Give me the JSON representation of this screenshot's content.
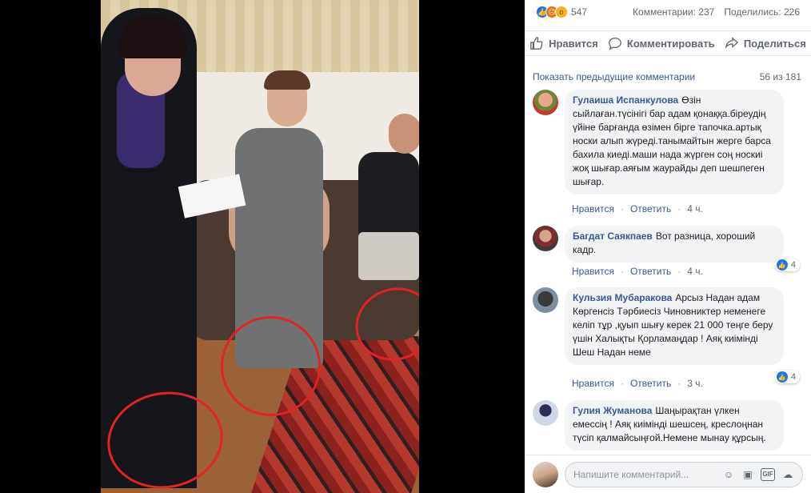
{
  "stats": {
    "reaction_count": "547",
    "comments": "Комментарии: 237",
    "shares": "Поделились: 226"
  },
  "actions": {
    "like": "Нравится",
    "comment": "Комментировать",
    "share": "Поделиться"
  },
  "previous": {
    "link": "Показать предыдущие комментарии",
    "count": "56 из 181"
  },
  "comments": [
    {
      "name": "Гулаиша Испанкулова",
      "text": "Өзін сыйлаған.түсінігі бар адам қонаққа.біреудің үйіне барғанда өзімен бірге тапочка.артық носки алып жүреді.танымайтын жерге барса бахила киеді.маши нада жүрген соң носкиі жоқ шығар.аяғым жаурайды деп шешпеген шығар.",
      "like": "Нравится",
      "reply": "Ответить",
      "time": "4 ч."
    },
    {
      "name": "Багдат Саякпаев",
      "text": "Вот разница, хороший кадр.",
      "like": "Нравится",
      "reply": "Ответить",
      "time": "4 ч.",
      "likes": "4"
    },
    {
      "name": "Кульзия Мубаракова",
      "text": "Арсыз Надан адам Көргенсіз Тәрбиесіз Чиновниктер неменеге келіп тұр ,қуып шығу керек 21 000 теңге беру үшін Халықты Қорламаңдар ! Аяқ киімінді Шеш Надан неме",
      "like": "Нравится",
      "reply": "Ответить",
      "time": "3 ч.",
      "likes": "4"
    },
    {
      "name": "Гулия Жуманова",
      "text": "Шаңырақтан үлкен емессің ! Аяқ киімінді шешсең, креслоңнан түсіп қалмайсыңғой.Немене мынау құрсың."
    }
  ],
  "composer": {
    "placeholder": "Напишите комментарий..."
  },
  "colors": {
    "link": "#385898",
    "bubble": "#f2f3f5",
    "like_blue": "#1877f2",
    "annotation_red": "#e22323"
  }
}
